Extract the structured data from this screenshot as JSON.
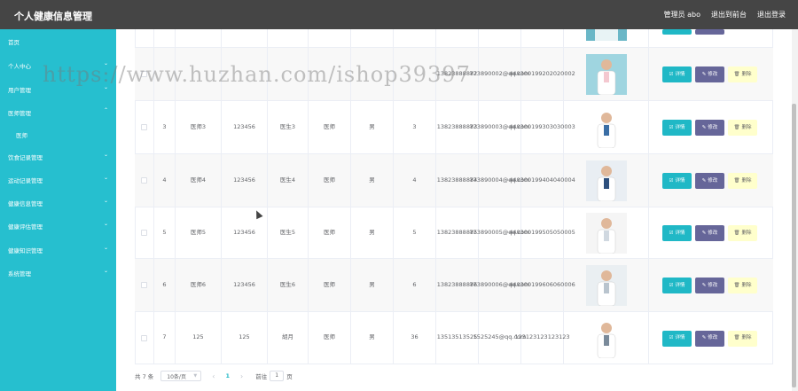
{
  "header": {
    "title": "个人健康信息管理",
    "admin_label": "管理员 abo",
    "to_frontend": "退出到前台",
    "logout": "退出登录"
  },
  "sidebar": {
    "items": [
      {
        "label": "首页"
      },
      {
        "label": "个人中心"
      },
      {
        "label": "用户管理"
      },
      {
        "label": "医师管理"
      },
      {
        "label": "医师"
      },
      {
        "label": "饮食记录管理"
      },
      {
        "label": "运动记录管理"
      },
      {
        "label": "健康信息管理"
      },
      {
        "label": "健康评估管理"
      },
      {
        "label": "健康知识管理"
      },
      {
        "label": "系统管理"
      }
    ]
  },
  "table": {
    "rows": [
      {
        "index": "",
        "account": "",
        "password": "",
        "name": "",
        "title": "",
        "gender": "",
        "age": "",
        "phone": "",
        "email": "",
        "idcard": ""
      },
      {
        "index": "",
        "account": "",
        "password": "",
        "name": "",
        "title": "",
        "gender": "",
        "age": "",
        "phone": "13823888882",
        "email": "773890002@qq.com",
        "idcard": "440300199202020002"
      },
      {
        "index": "3",
        "account": "医师3",
        "password": "123456",
        "name": "医生3",
        "title": "医师",
        "gender": "男",
        "age": "3",
        "phone": "13823888883",
        "email": "773890003@qq.com",
        "idcard": "440300199303030003"
      },
      {
        "index": "4",
        "account": "医师4",
        "password": "123456",
        "name": "医生4",
        "title": "医师",
        "gender": "男",
        "age": "4",
        "phone": "13823888884",
        "email": "773890004@qq.com",
        "idcard": "440300199404040004"
      },
      {
        "index": "5",
        "account": "医师5",
        "password": "123456",
        "name": "医生5",
        "title": "医师",
        "gender": "男",
        "age": "5",
        "phone": "13823888885",
        "email": "773890005@qq.com",
        "idcard": "440300199505050005"
      },
      {
        "index": "6",
        "account": "医师6",
        "password": "123456",
        "name": "医生6",
        "title": "医师",
        "gender": "男",
        "age": "6",
        "phone": "13823888886",
        "email": "773890006@qq.com",
        "idcard": "440300199606060006"
      },
      {
        "index": "7",
        "account": "125",
        "password": "125",
        "name": "胡月",
        "title": "医师",
        "gender": "男",
        "age": "36",
        "phone": "13513513525",
        "email": "1525245@qq.com",
        "idcard": "123123123123123"
      }
    ],
    "actions": {
      "detail": "详情",
      "edit": "修改",
      "delete": "删除"
    }
  },
  "pager": {
    "total": "共 7 条",
    "page_size": "10条/页",
    "current": "1",
    "goto_label": "前往",
    "goto_value": "1",
    "page_suffix": "页"
  },
  "watermark": "https://www.huzhan.com/ishop39397",
  "colors": {
    "sidebar": "#26bfcf",
    "topbar": "#454545",
    "detail": "#20b8c6",
    "edit": "#666699",
    "delete": "#ffffcc"
  }
}
